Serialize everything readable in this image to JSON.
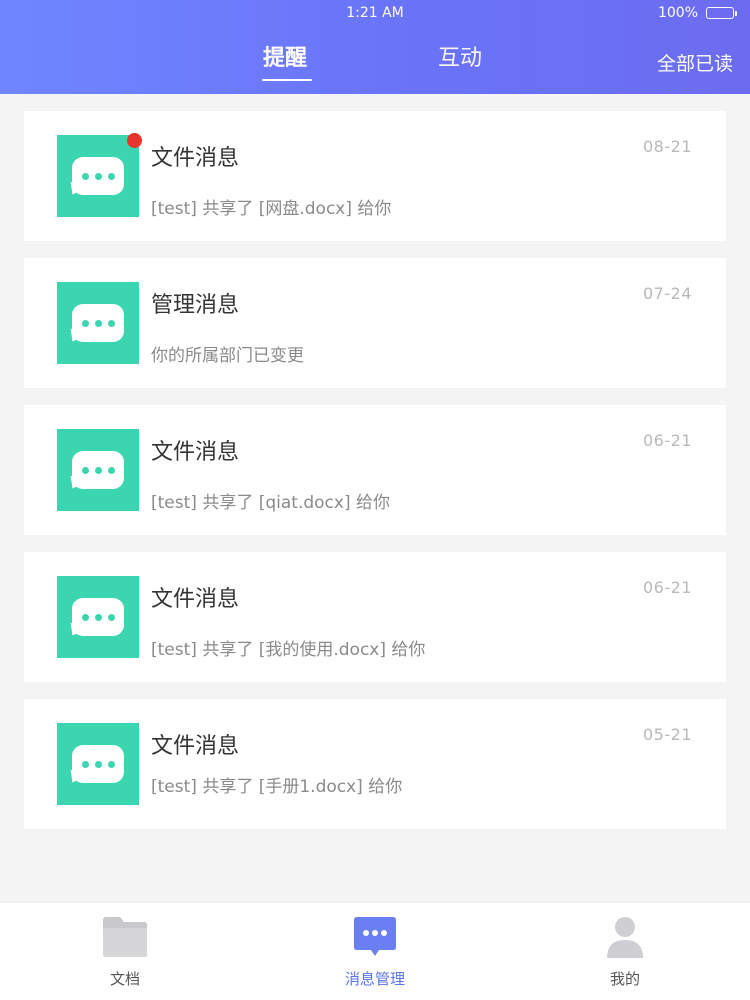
{
  "status_bar": {
    "time": "1:21 AM",
    "battery": "100%"
  },
  "header": {
    "tabs": [
      {
        "label": "提醒",
        "active": true
      },
      {
        "label": "互动",
        "active": false
      }
    ],
    "mark_all_read": "全部已读"
  },
  "messages": [
    {
      "title": "文件消息",
      "desc": "[test] 共享了 [网盘.docx] 给你",
      "date": "08-21",
      "unread": true
    },
    {
      "title": "管理消息",
      "desc": "你的所属部门已变更",
      "date": "07-24",
      "unread": false
    },
    {
      "title": "文件消息",
      "desc": "[test] 共享了 [qiat.docx] 给你",
      "date": "06-21",
      "unread": false
    },
    {
      "title": "文件消息",
      "desc": "[test] 共享了 [我的使用.docx] 给你",
      "date": "06-21",
      "unread": false
    },
    {
      "title": "文件消息",
      "desc": "[test] 共享了 [手册1.docx] 给你",
      "date": "05-21",
      "unread": false
    }
  ],
  "tabbar": {
    "items": [
      {
        "label": "文档",
        "icon": "folder-icon",
        "active": false
      },
      {
        "label": "消息管理",
        "icon": "message-icon",
        "active": true
      },
      {
        "label": "我的",
        "icon": "user-icon",
        "active": false
      }
    ]
  },
  "colors": {
    "header_gradient_start": "#6f86ff",
    "header_gradient_end": "#6c6cf0",
    "message_icon_bg": "#3bd6b0",
    "unread_dot": "#e8342b",
    "tabbar_active": "#5b73ef"
  }
}
